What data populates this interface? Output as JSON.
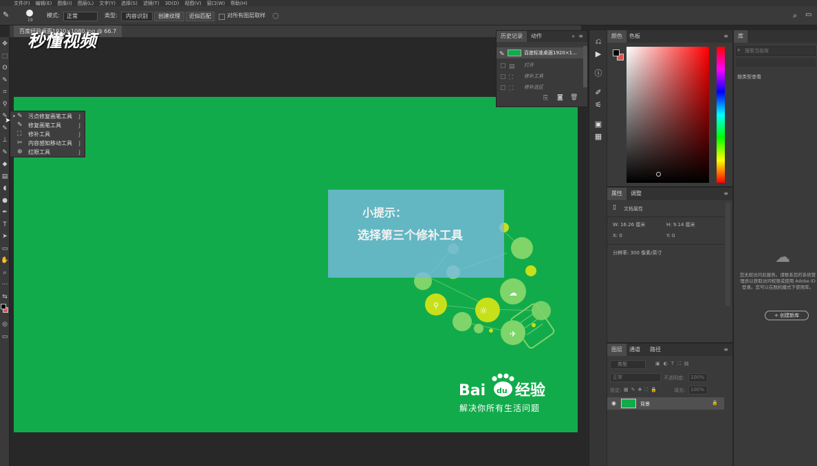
{
  "menubar": [
    "文件(F)",
    "编辑(E)",
    "图像(I)",
    "图层(L)",
    "文字(Y)",
    "选择(S)",
    "滤镜(T)",
    "3D(D)",
    "视图(V)",
    "窗口(W)",
    "帮助(H)"
  ],
  "options": {
    "mode_label": "模式:",
    "mode_value": "正常",
    "type_label": "类型:",
    "btn_content": "内容识别",
    "btn_texture": "创建纹理",
    "btn_proximity": "近似匹配",
    "sample_all": "对所有图层取样",
    "brush_size": "19"
  },
  "doc_tab": "百度经验桌面1920×1080.jpg @ 66.7",
  "watermark": "秒懂视频",
  "flyout": [
    {
      "label": "污点修复画笔工具",
      "key": "J",
      "icon": "spot-heal-icon"
    },
    {
      "label": "修复画笔工具",
      "key": "J",
      "icon": "heal-brush-icon"
    },
    {
      "label": "修补工具",
      "key": "J",
      "icon": "patch-icon"
    },
    {
      "label": "内容感知移动工具",
      "key": "J",
      "icon": "content-move-icon"
    },
    {
      "label": "红眼工具",
      "key": "J",
      "icon": "red-eye-icon"
    }
  ],
  "canvas": {
    "tip_title": "小提示：",
    "tip_body": "选择第三个修补工具",
    "brand_text": "Bai经验",
    "brand_du": "du",
    "slogan": "解决你所有生活问题"
  },
  "history": {
    "tab_history": "历史记录",
    "tab_actions": "动作",
    "rows": [
      "百度标准桌面1920×1...",
      "打开",
      "修补工具",
      "修补选区"
    ]
  },
  "color": {
    "tab_color": "颜色",
    "tab_swatches": "色板",
    "fg": "#000000",
    "bg": "#d9534f"
  },
  "props": {
    "tab_props": "属性",
    "tab_adjust": "调整",
    "doc_props": "文档属性",
    "w": "W:  16.26 厘米",
    "h": "H:  9.14 厘米",
    "x": "X:  0",
    "y": "Y:  0",
    "resolution": "分辨率: 300 像素/英寸"
  },
  "layers": {
    "tab_layers": "图层",
    "tab_channels": "通道",
    "tab_paths": "路径",
    "kind": "类型",
    "blend": "正常",
    "opacity": "不透明度:",
    "opacity_val": "100%",
    "lock": "锁定:",
    "fill": "填充:",
    "fill_val": "100%",
    "layer_name": "背景"
  },
  "library": {
    "tab": "库",
    "search_placeholder": "搜索当前库",
    "view": "按类型查看",
    "message": "您无权访问此服务。请联系您的系统管理员以获取访问权限或使用 Adobe ID 登录。您可以在脱机模式下使用库。",
    "create_btn": "+ 创建新库"
  }
}
